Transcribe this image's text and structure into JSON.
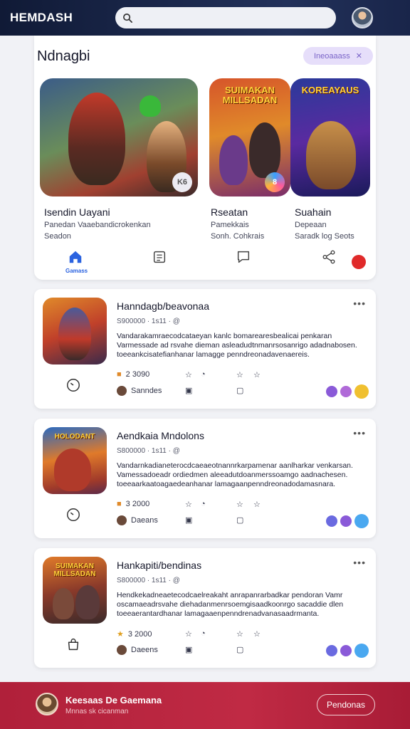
{
  "header": {
    "brand": "HEMDASH",
    "search_placeholder": ""
  },
  "featured": {
    "title": "Ndnagbi",
    "view_all": "Ineoaaass",
    "cards": [
      {
        "name": "Isendin Uayani",
        "line1": "Panedan Vaaebandicrokenkan",
        "line2": "Seadon",
        "badge": "K6"
      },
      {
        "name": "Rseatan",
        "art_title": "SUIMAKAN MILLSADAN",
        "line1": "Pamekkais",
        "line2": "Sonh. Cohkrais"
      },
      {
        "name": "Suahain",
        "art_title": "KOREAYAUS",
        "line1": "Depeaan",
        "line2": "Saradk log Seots"
      }
    ],
    "nav": {
      "home_label": "Gamass"
    }
  },
  "list": [
    {
      "title": "Hanndagb/beavonaa",
      "meta": "S900000 · 1s11 · @",
      "desc": "Vandarakamraecodcataeyan kanlc bomarearesbealicai penkaran Varmessade ad rsvahe dieman asleadudtnmanrsosanrigo adadnabosen. toeeankcisatefianhanar lamagge penndreonadavenaereis.",
      "stat": "2 3090",
      "tag": "Sanndes",
      "chips": [
        "#8a5ad8",
        "#b06ad8",
        "#f0c030"
      ]
    },
    {
      "title": "Aendkaia Mndolons",
      "art_title": "HOLODANT",
      "meta": "S800000 · 1s11 · @",
      "desc": "Vandarnkadianeterocdcaeaeotnannrkarpamenar aanlharkar venkarsan. Vamessadoeadr ordiedmen aleeadutdoanmerssoamgo aadnachesen. toeeaarkaatoagaedeanhanar lamagaanpenndreonadodamasnara.",
      "stat": "3 2000",
      "tag": "Daeans",
      "chips": [
        "#6a6ae0",
        "#8a5ad8",
        "#4aa8f0"
      ]
    },
    {
      "title": "Hankapiti/bendinas",
      "art_title": "SUIMAKAN MILLSADAN",
      "meta": "S800000 · 1s11 · @",
      "desc": "Hendkekadneaetecodcaelreakaht anrapanrarbadkar pendoran Vamr oscamaeadrsvahe diehadanmenrsoemgisaadkoonrgo sacaddie dlen toeeaerantardhanar lamagaaenpenndrenadvanasaadrmanta.",
      "stat": "3 2000",
      "tag": "Daeens",
      "chips": [
        "#6a6ae0",
        "#8a5ad8",
        "#4aa8f0"
      ]
    }
  ],
  "bottom_bar": {
    "title": "Keesaas De Gaemana",
    "subtitle": "Mnnas sk cicanman",
    "button": "Pendonas"
  }
}
